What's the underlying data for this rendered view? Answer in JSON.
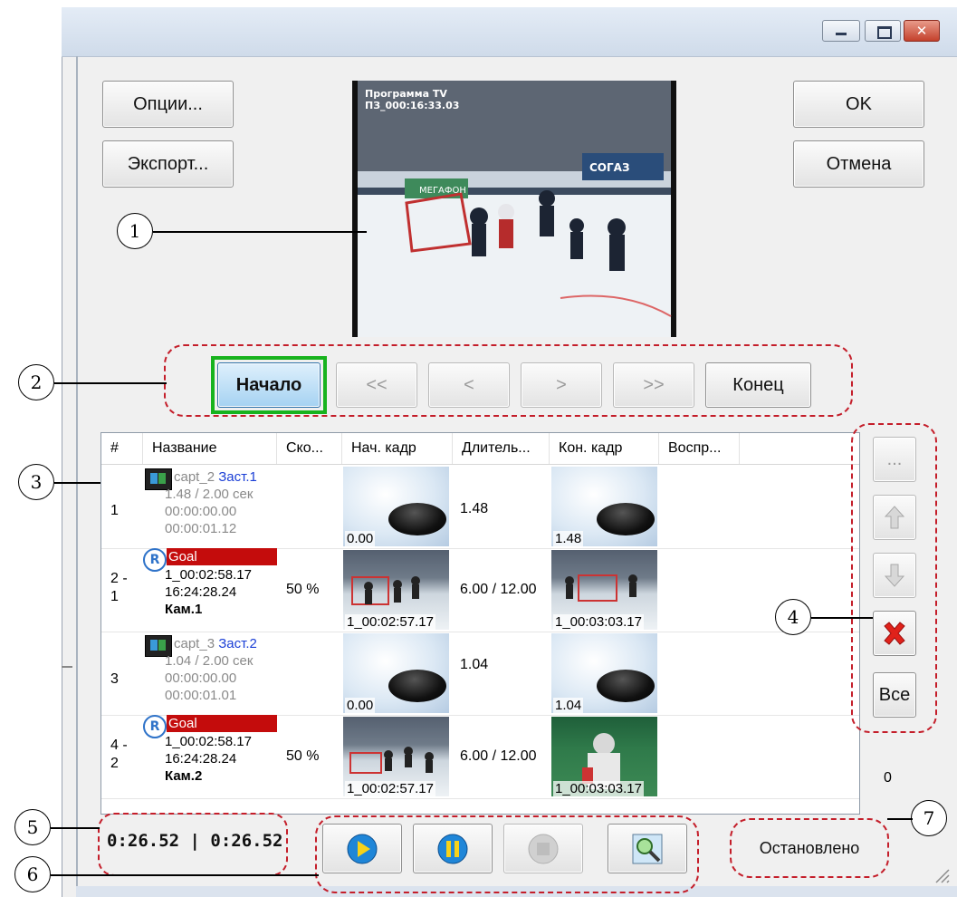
{
  "buttons": {
    "options": "Опции...",
    "export": "Экспорт...",
    "ok": "OK",
    "cancel": "Отмена"
  },
  "video": {
    "overlay_line1": "Программа TV",
    "overlay_line2": "ПЗ_000:16:33.03",
    "sponsor1": "СОГАЗ",
    "sponsor2": "МЕГАФОН"
  },
  "nav": {
    "start": "Начало",
    "prev_fast": "<<",
    "prev": "<",
    "next": ">",
    "next_fast": ">>",
    "end": "Конец"
  },
  "table": {
    "columns": [
      "#",
      "Название",
      "Ско...",
      "Нач. кадр",
      "Длитель...",
      "Кон. кадр",
      "Воспр..."
    ],
    "rows": [
      {
        "num": "1",
        "name": "capt_2",
        "tag": "Заст.1",
        "line2": "1.48 / 2.00 сек",
        "line3": "00:00:00.00",
        "line4": "00:00:01.12",
        "speed": "",
        "start_label": "0.00",
        "duration": "1.48",
        "end_label": "1.48"
      },
      {
        "num": "2 - 1",
        "name": "Goal",
        "line2": "1_00:02:58.17",
        "line3": "16:24:28.24",
        "line4": "Кам.1",
        "speed": "50 %",
        "start_label": "1_00:02:57.17",
        "duration": "6.00 / 12.00",
        "end_label": "1_00:03:03.17"
      },
      {
        "num": "3",
        "name": "capt_3",
        "tag": "Заст.2",
        "line2": "1.04 / 2.00 сек",
        "line3": "00:00:00.00",
        "line4": "00:00:01.01",
        "speed": "",
        "start_label": "0.00",
        "duration": "1.04",
        "end_label": "1.04"
      },
      {
        "num": "4 - 2",
        "name": "Goal",
        "line2": "1_00:02:58.17",
        "line3": "16:24:28.24",
        "line4": "Кам.2",
        "speed": "50 %",
        "start_label": "1_00:02:57.17",
        "duration": "6.00 / 12.00",
        "end_label": "1_00:03:03.17"
      }
    ]
  },
  "side": {
    "more": "...",
    "all": "Все",
    "counter": "0"
  },
  "time_display": "0:26.52 | 0:26.52",
  "status": "Остановлено",
  "callouts": [
    "1",
    "2",
    "3",
    "4",
    "5",
    "6",
    "7"
  ],
  "colors": {
    "accent_dash": "#c41e2a",
    "highlight": "#18b31e",
    "goal_tag": "#c40c0c"
  },
  "icons": {
    "play": "play-icon",
    "pause": "pause-icon",
    "stop": "stop-icon",
    "preview": "zoom-preview-icon",
    "up": "arrow-up-icon",
    "down": "arrow-down-icon",
    "delete": "delete-x-icon"
  }
}
